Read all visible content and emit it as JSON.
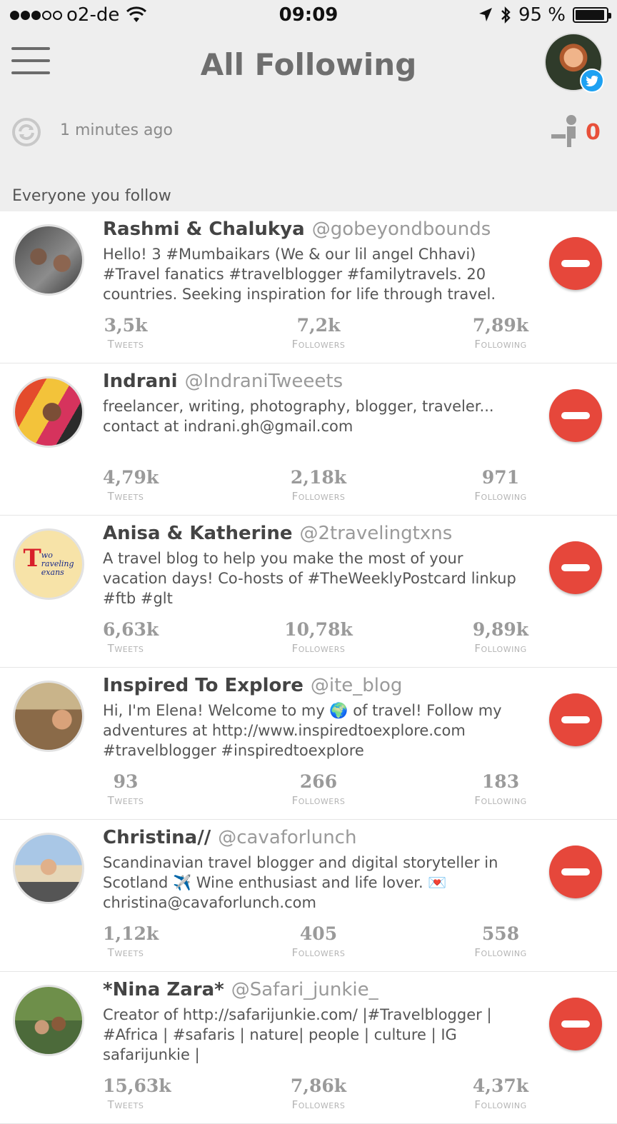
{
  "status_bar": {
    "carrier": "o2-de",
    "time": "09:09",
    "battery": "95 %",
    "signal_bars_filled": 3,
    "signal_bars_total": 5
  },
  "header": {
    "title": "All Following"
  },
  "sync": {
    "updated": "1 minutes ago",
    "unfollow_count": "0"
  },
  "section_label": "Everyone you follow",
  "stat_labels": {
    "tweets": "Tweets",
    "followers": "Followers",
    "following": "Following"
  },
  "users": [
    {
      "name": "Rashmi & Chalukya",
      "handle": "@gobeyondbounds",
      "bio": "Hello! 3 #Mumbaikars (We & our lil angel Chhavi) #Travel fanatics #travelblogger  #familytravels. 20 countries. Seeking inspiration for life through travel.",
      "tweets": "3,5k",
      "followers": "7,2k",
      "following": "7,89k"
    },
    {
      "name": "Indrani",
      "handle": "@IndraniTweeets",
      "bio": "freelancer, writing, photography, blogger, traveler... contact at indrani.gh@gmail.com",
      "tweets": "4,79k",
      "followers": "2,18k",
      "following": "971"
    },
    {
      "name": "Anisa & Katherine",
      "handle": "@2travelingtxns",
      "bio": "A travel blog to help you make the most of your vacation days! Co-hosts of #TheWeeklyPostcard linkup #ftb #glt",
      "tweets": "6,63k",
      "followers": "10,78k",
      "following": "9,89k"
    },
    {
      "name": "Inspired To Explore",
      "handle": "@ite_blog",
      "bio": "Hi, I'm Elena! Welcome to my 🌍 of travel! Follow my adventures at http://www.inspiredtoexplore.com #travelblogger #inspiredtoexplore",
      "tweets": "93",
      "followers": "266",
      "following": "183"
    },
    {
      "name": "Christina//",
      "handle": "@cavaforlunch",
      "bio": "Scandinavian travel blogger and digital storyteller in Scotland ✈️ Wine enthusiast and life lover. 💌 christina@cavaforlunch.com",
      "tweets": "1,12k",
      "followers": "405",
      "following": "558"
    },
    {
      "name": "*Nina Zara*",
      "handle": "@Safari_junkie_",
      "bio": "Creator of http://safarijunkie.com/ |#Travelblogger | #Africa | #safaris | nature| people | culture | IG safarijunkie |",
      "tweets": "15,63k",
      "followers": "7,86k",
      "following": "4,37k"
    }
  ],
  "avatar_3_text": {
    "initial": "T",
    "line1": "wo",
    "line2": "raveling",
    "line3": "exans"
  },
  "colors": {
    "accent_red": "#e6473b",
    "header_bg": "#eeeeee",
    "twitter_blue": "#1da1f2"
  }
}
